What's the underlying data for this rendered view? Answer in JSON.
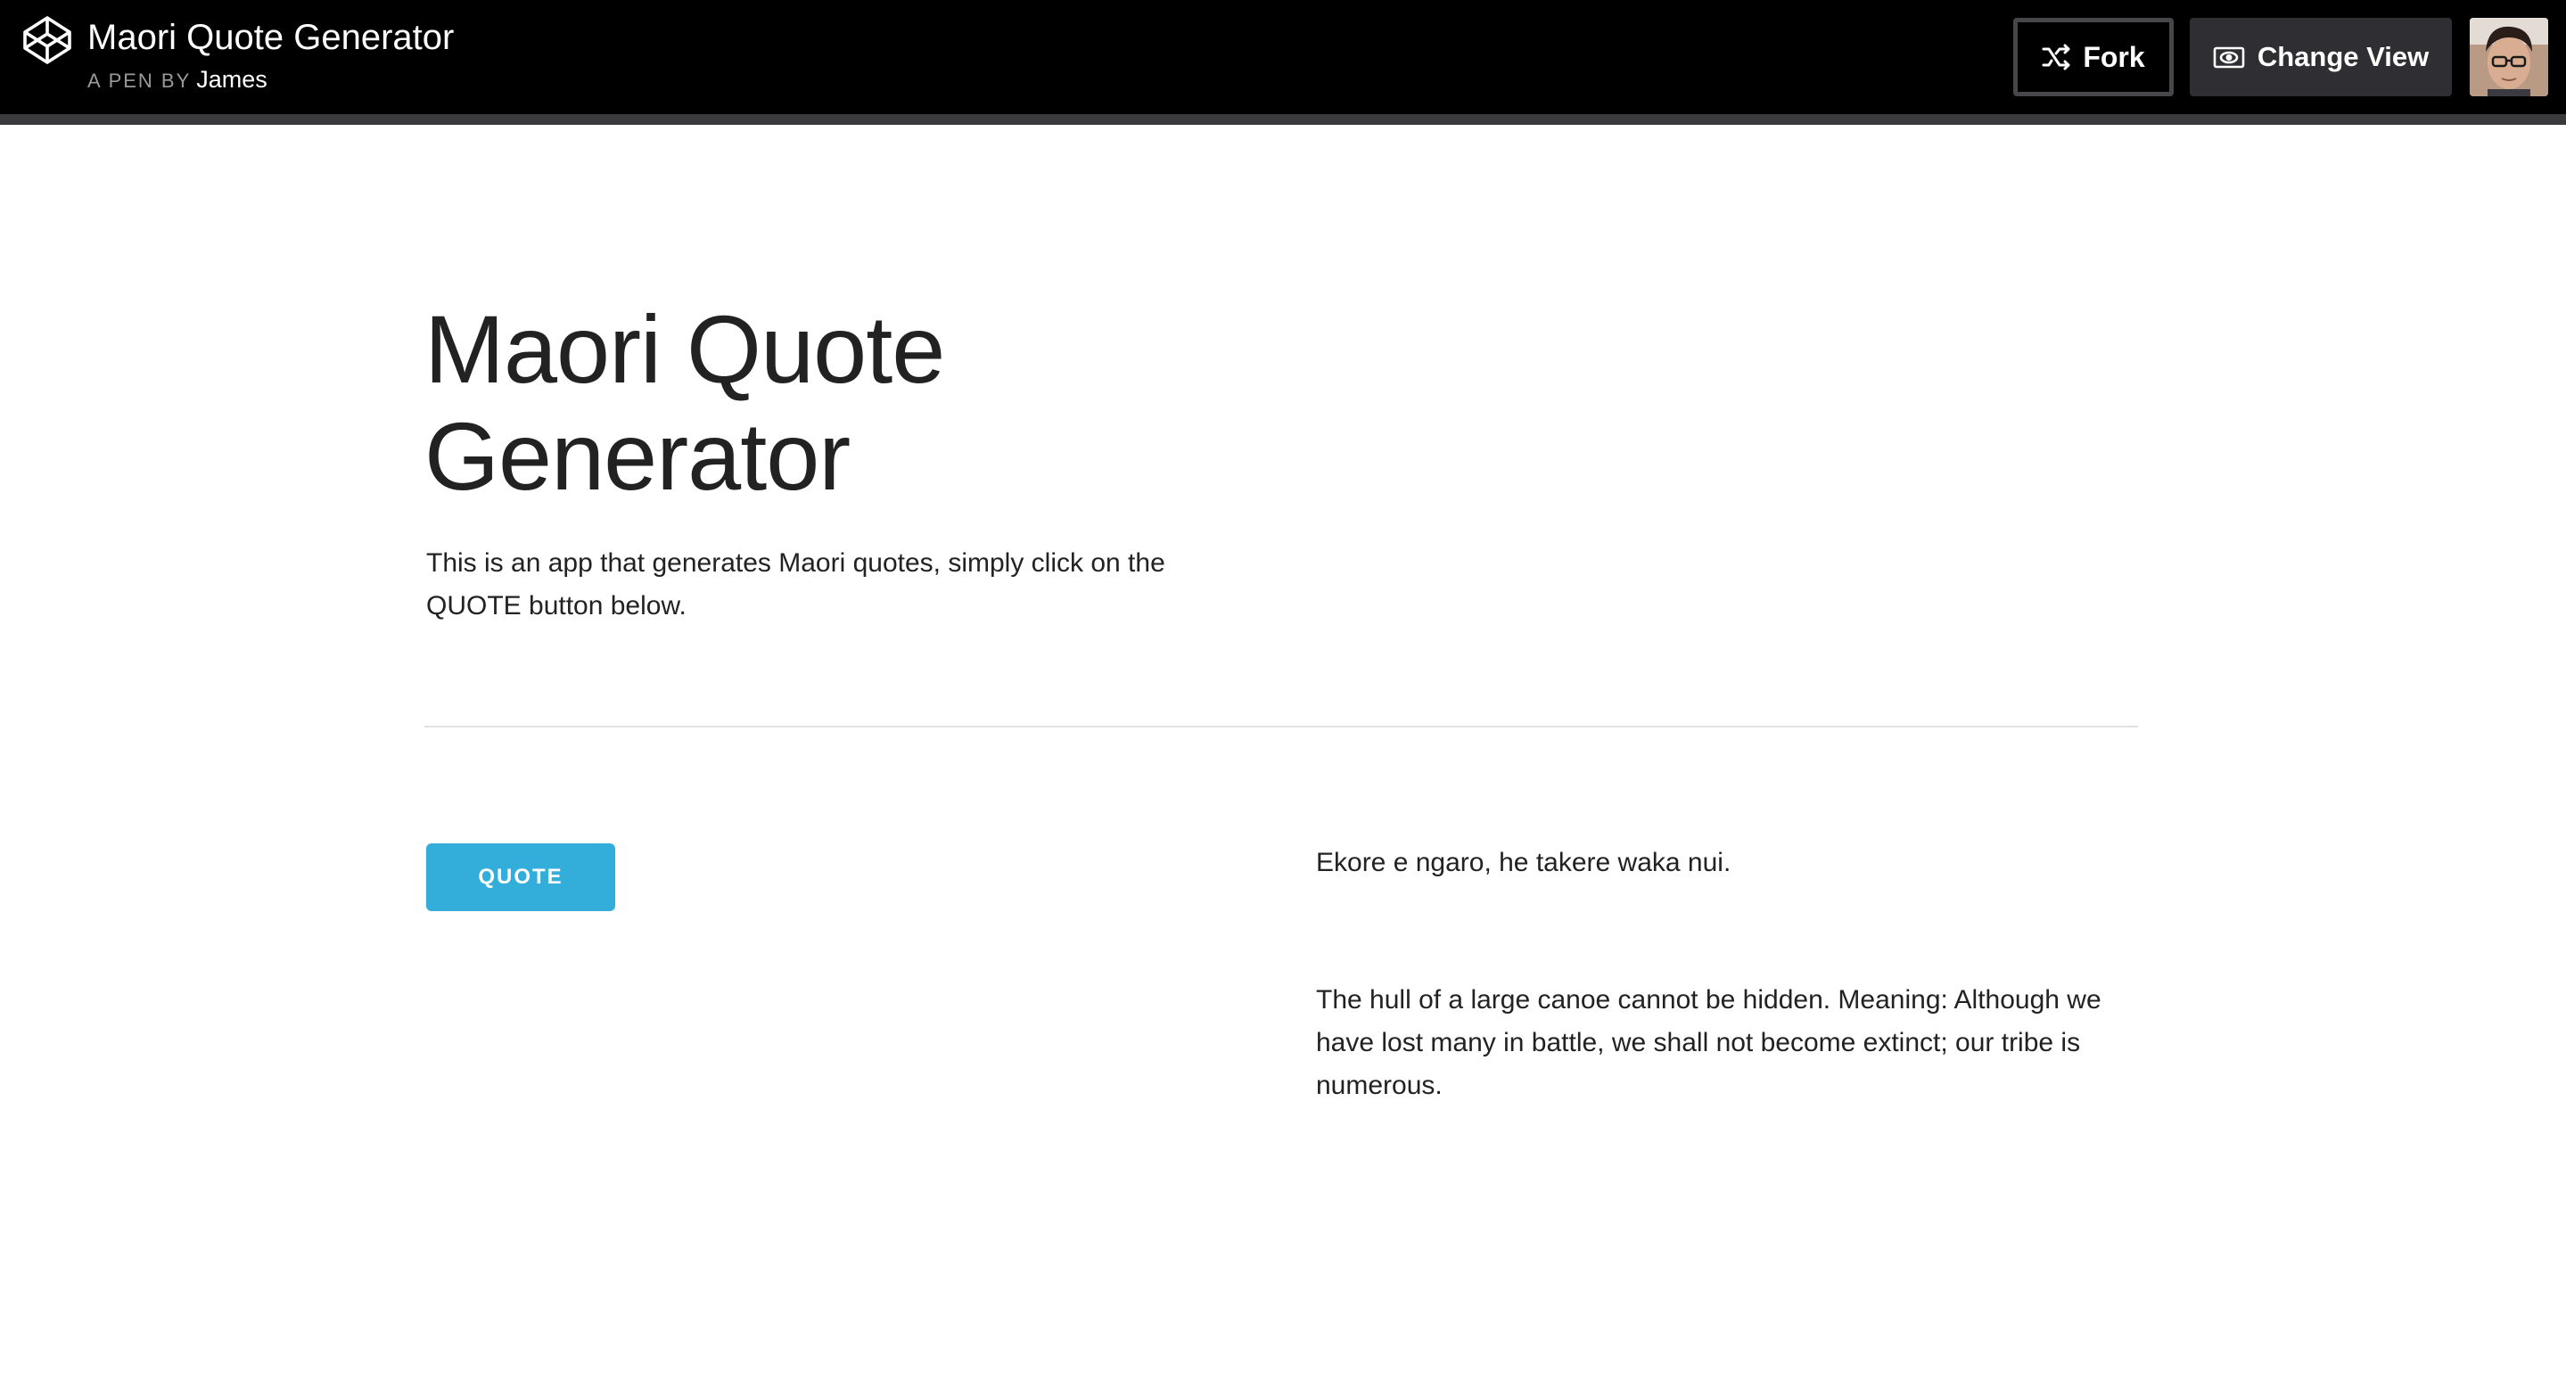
{
  "header": {
    "title": "Maori Quote Generator",
    "byline_prefix": "A PEN BY",
    "author": "James",
    "fork_label": "Fork",
    "change_view_label": "Change View",
    "icons": {
      "logo": "codepen-logo-icon",
      "fork": "fork-icon",
      "change_view": "eye-icon"
    }
  },
  "main": {
    "title": "Maori Quote Generator",
    "intro": "This is an app that generates Maori quotes, simply click on the QUOTE button below.",
    "quote_button_label": "QUOTE",
    "quote_maori": "Ekore e ngaro, he takere waka nui.",
    "quote_english": "The hull of a large canoe cannot be hidden. Meaning: Although we have lost many in battle, we shall not become extinct; our tribe is numerous."
  },
  "colors": {
    "header_bg": "#000000",
    "accent_button": "#33aedb",
    "text": "#222222"
  }
}
